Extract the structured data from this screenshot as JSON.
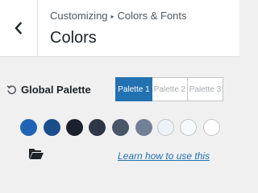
{
  "header": {
    "breadcrumb_parent": "Customizing",
    "breadcrumb_separator": "▸",
    "breadcrumb_section": "Colors & Fonts",
    "title": "Colors",
    "back_icon": "chevron-left-icon"
  },
  "global_palette": {
    "label": "Global Palette",
    "reset_icon": "reset-icon",
    "tabs": [
      {
        "label": "Palette 1",
        "active": true
      },
      {
        "label": "Palette 2",
        "active": false
      },
      {
        "label": "Palette 3",
        "active": false
      }
    ],
    "swatches": [
      {
        "name": "palette-color-1",
        "color": "#2164b6"
      },
      {
        "name": "palette-color-2",
        "color": "#1b4d8a"
      },
      {
        "name": "palette-color-3",
        "color": "#1a202c"
      },
      {
        "name": "palette-color-4",
        "color": "#2d3748"
      },
      {
        "name": "palette-color-5",
        "color": "#4a5568"
      },
      {
        "name": "palette-color-6",
        "color": "#718096"
      },
      {
        "name": "palette-color-7",
        "color": "#edf2f7"
      },
      {
        "name": "palette-color-8",
        "color": "#f7fafc"
      },
      {
        "name": "palette-color-9",
        "color": "#ffffff"
      }
    ],
    "folder_icon": "folder-open-icon",
    "learn_link": "Learn how to use this"
  },
  "colors": {
    "accent": "#2271b1"
  }
}
